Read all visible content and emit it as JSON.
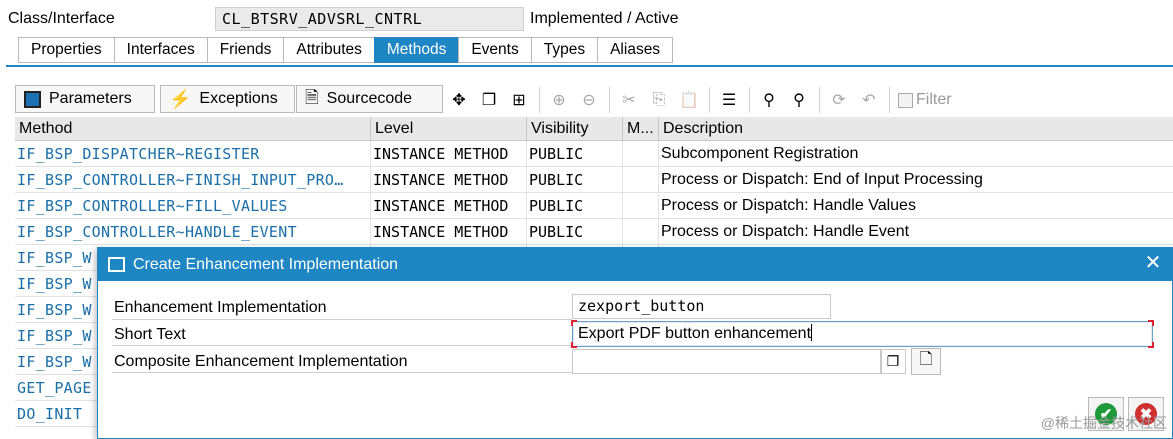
{
  "header": {
    "label": "Class/Interface",
    "class_name": "CL_BTSRV_ADVSRL_CNTRL",
    "status": "Implemented / Active"
  },
  "main_tabs": [
    "Properties",
    "Interfaces",
    "Friends",
    "Attributes",
    "Methods",
    "Events",
    "Types",
    "Aliases"
  ],
  "active_tab": "Methods",
  "toolbar": {
    "parameters_label": "Parameters",
    "exceptions_label": "Exceptions",
    "sourcecode_label": "Sourcecode",
    "filter_label": "Filter"
  },
  "table": {
    "columns": [
      "Method",
      "Level",
      "Visibility",
      "M...",
      "Description"
    ],
    "rows": [
      {
        "method": "IF_BSP_DISPATCHER~REGISTER",
        "level": "INSTANCE METHOD",
        "visibility": "PUBLIC",
        "m": "",
        "description": "Subcomponent Registration"
      },
      {
        "method": "IF_BSP_CONTROLLER~FINISH_INPUT_PRO…",
        "level": "INSTANCE METHOD",
        "visibility": "PUBLIC",
        "m": "",
        "description": "Process or Dispatch: End of Input Processing"
      },
      {
        "method": "IF_BSP_CONTROLLER~FILL_VALUES",
        "level": "INSTANCE METHOD",
        "visibility": "PUBLIC",
        "m": "",
        "description": "Process or Dispatch: Handle Values"
      },
      {
        "method": "IF_BSP_CONTROLLER~HANDLE_EVENT",
        "level": "INSTANCE METHOD",
        "visibility": "PUBLIC",
        "m": "",
        "description": "Process or Dispatch: Handle Event"
      },
      {
        "method": "IF_BSP_W",
        "level": "",
        "visibility": "",
        "m": "",
        "description": ""
      },
      {
        "method": "IF_BSP_W",
        "level": "",
        "visibility": "",
        "m": "",
        "description": ""
      },
      {
        "method": "IF_BSP_W",
        "level": "",
        "visibility": "",
        "m": "",
        "description": ""
      },
      {
        "method": "IF_BSP_W",
        "level": "",
        "visibility": "",
        "m": "",
        "description": ""
      },
      {
        "method": "IF_BSP_W",
        "level": "",
        "visibility": "",
        "m": "",
        "description": ""
      },
      {
        "method": "GET_PAGE",
        "level": "",
        "visibility": "",
        "m": "",
        "description": ""
      },
      {
        "method": "DO_INIT",
        "level": "",
        "visibility": "",
        "m": "",
        "description": ""
      }
    ]
  },
  "dialog": {
    "title": "Create Enhancement Implementation",
    "fields": {
      "impl_label": "Enhancement Implementation",
      "impl_value": "zexport_button",
      "short_label": "Short Text",
      "short_value": "Export PDF button enhancement",
      "composite_label": "Composite Enhancement Implementation",
      "composite_value": ""
    }
  },
  "watermark": "@稀土掘金技术社区",
  "colors": {
    "accent": "#1f86c4",
    "method_link": "#1b6fa8",
    "ok_green": "#1f9a3a",
    "cancel_red": "#d0302f"
  }
}
